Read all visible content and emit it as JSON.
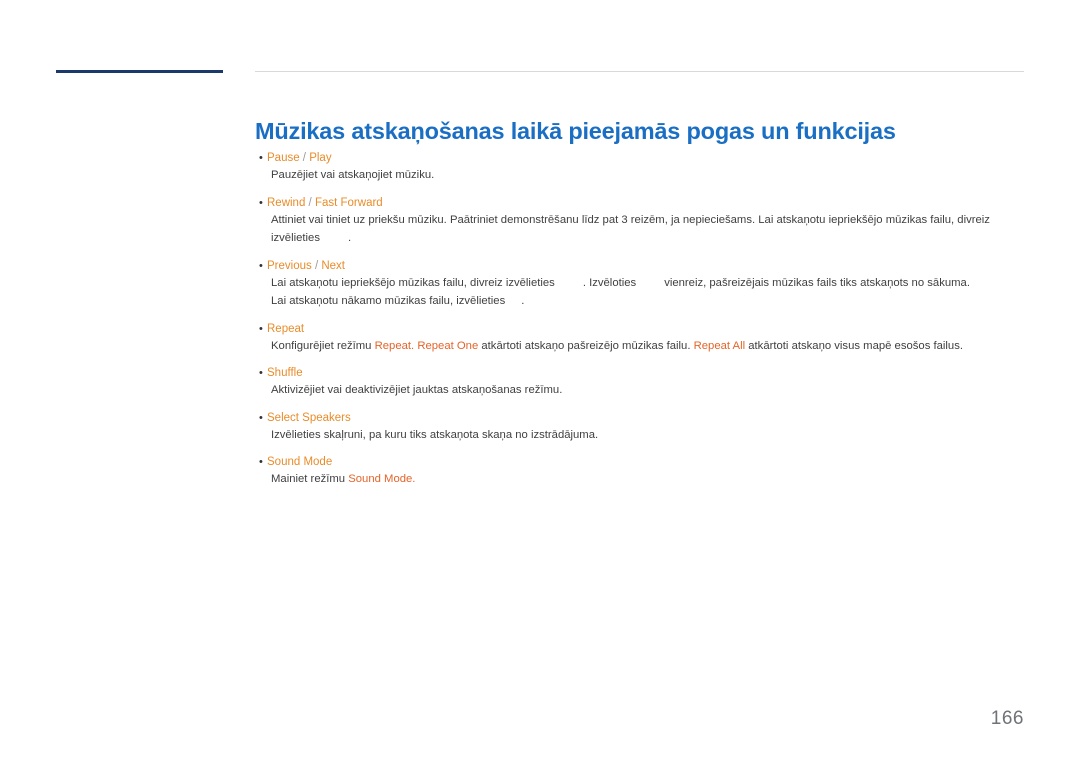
{
  "document": {
    "title": "Mūzikas atskaņošanas laikā pieejamās pogas un funkcijas",
    "page_number": "166",
    "accent_color": "#1a6fc4",
    "label_color": "#e98c2a",
    "highlight_color": "#e4642a",
    "rule_color": "#1b3a6b"
  },
  "items": [
    {
      "label": "Pause",
      "label_sep": "/",
      "label_alt": "Play",
      "lines": [
        {
          "parts": [
            {
              "t": "Pauzējiet vai atskaņojiet mūziku.",
              "hl": false
            }
          ]
        }
      ]
    },
    {
      "label": "Rewind",
      "label_sep": "/",
      "label_alt": "Fast Forward",
      "lines": [
        {
          "parts": [
            {
              "t": "Attiniet vai tiniet uz priekšu mūziku. Paātriniet demonstrēšanu līdz pat 3 reizēm, ja nepieciešams. Lai atskaņotu iepriekšējo mūzikas failu, divreiz",
              "hl": false
            }
          ]
        },
        {
          "parts": [
            {
              "t": "izvēlieties",
              "hl": false
            },
            {
              "t": "gap",
              "hl": false
            },
            {
              "t": ".",
              "hl": false
            }
          ]
        }
      ]
    },
    {
      "label": "Previous",
      "label_sep": "/",
      "label_alt": "Next",
      "lines": [
        {
          "parts": [
            {
              "t": "Lai atskaņotu iepriekšējo mūzikas failu, divreiz izvēlieties",
              "hl": false
            },
            {
              "t": "gap",
              "hl": false
            },
            {
              "t": ". Izvēloties",
              "hl": false
            },
            {
              "t": "gap",
              "hl": false
            },
            {
              "t": "vienreiz, pašreizējais mūzikas fails tiks atskaņots no sākuma.",
              "hl": false
            }
          ]
        },
        {
          "parts": [
            {
              "t": "Lai atskaņotu nākamo mūzikas failu, izvēlieties",
              "hl": false
            },
            {
              "t": "gap-sm",
              "hl": false
            },
            {
              "t": ".",
              "hl": false
            }
          ]
        }
      ]
    },
    {
      "label": "Repeat",
      "label_sep": "",
      "label_alt": "",
      "lines": [
        {
          "parts": [
            {
              "t": "Konfigurējiet režīmu ",
              "hl": false
            },
            {
              "t": "Repeat. Repeat One",
              "hl": true
            },
            {
              "t": " atkārtoti atskaņo pašreizējo mūzikas failu. ",
              "hl": false
            },
            {
              "t": "Repeat All",
              "hl": true
            },
            {
              "t": " atkārtoti atskaņo visus mapē esošos failus.",
              "hl": false
            }
          ]
        }
      ]
    },
    {
      "label": "Shuffle",
      "label_sep": "",
      "label_alt": "",
      "lines": [
        {
          "parts": [
            {
              "t": "Aktivizējiet vai deaktivizējiet jauktas atskaņošanas režīmu.",
              "hl": false
            }
          ]
        }
      ]
    },
    {
      "label": "Select Speakers",
      "label_sep": "",
      "label_alt": "",
      "lines": [
        {
          "parts": [
            {
              "t": "Izvēlieties skaļruni, pa kuru tiks atskaņota skaņa no izstrādājuma.",
              "hl": false
            }
          ]
        }
      ]
    },
    {
      "label": "Sound Mode",
      "label_sep": "",
      "label_alt": "",
      "lines": [
        {
          "parts": [
            {
              "t": "Mainiet režīmu ",
              "hl": false
            },
            {
              "t": "Sound Mode.",
              "hl": true
            }
          ]
        }
      ]
    }
  ]
}
